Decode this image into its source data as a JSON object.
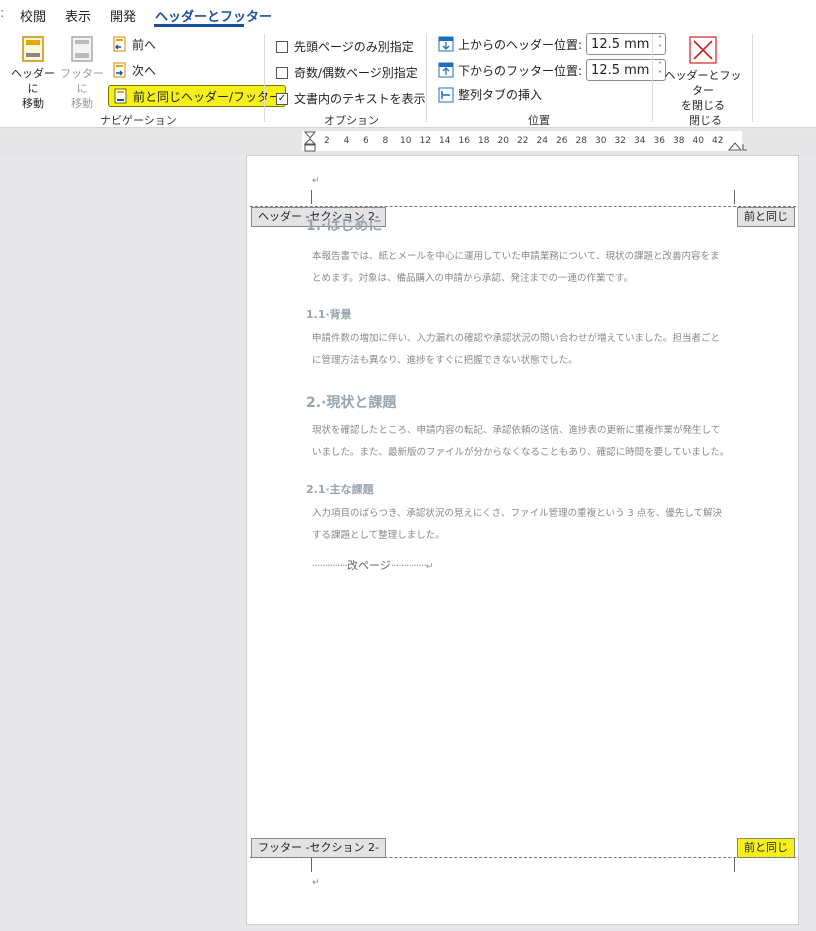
{
  "tabs": [
    {
      "label": "校閲"
    },
    {
      "label": "表示"
    },
    {
      "label": "開発"
    },
    {
      "label": "ヘッダーとフッター"
    }
  ],
  "navigation": {
    "group_label": "ナビゲーション",
    "goto_header_line1": "ヘッダーに",
    "goto_header_line2": "移動",
    "goto_footer_line1": "フッターに",
    "goto_footer_line2": "移動",
    "prev_label": "前へ",
    "next_label": "次へ",
    "link_prev_label": "前と同じヘッダー/フッター"
  },
  "options": {
    "group_label": "オプション",
    "different_first": {
      "label": "先頭ページのみ別指定",
      "checked": false
    },
    "different_odd_even": {
      "label": "奇数/偶数ページ別指定",
      "checked": false
    },
    "show_doc_text": {
      "label": "文書内のテキストを表示",
      "checked": true
    }
  },
  "position": {
    "group_label": "位置",
    "header_from_top_label": "上からのヘッダー位置:",
    "header_from_top_value": "12.5 mm",
    "footer_from_bottom_label": "下からのフッター位置:",
    "footer_from_bottom_value": "12.5 mm",
    "insert_align_tab_label": "整列タブの挿入"
  },
  "close": {
    "group_label": "閉じる",
    "close_line1": "ヘッダーとフッター",
    "close_line2": "を閉じる"
  },
  "ruler": {
    "ticks": [
      "2",
      "4",
      "6",
      "8",
      "10",
      "12",
      "14",
      "16",
      "18",
      "20",
      "22",
      "24",
      "26",
      "28",
      "30",
      "32",
      "34",
      "36",
      "38",
      "40",
      "42"
    ]
  },
  "page": {
    "header_tag": "ヘッダー -セクション 2-",
    "header_same_as_prev": "前と同じ",
    "footer_tag": "フッター -セクション 2-",
    "footer_same_as_prev": "前と同じ",
    "heading1": "1.·はじめに",
    "intro_p1": "本報告書では、紙とメールを中心に運用していた申請業務について、現状の課題と改善内容をま",
    "intro_p2": "とめます。対象は、備品購入の申請から承認、発注までの一連の作業です。",
    "h1_1": "1.1·背景",
    "bg_p1": "申請件数の増加に伴い、入力漏れの確認や承認状況の問い合わせが増えていました。担当者ごと",
    "bg_p2": "に管理方法も異なり、進捗をすぐに把握できない状態でした。",
    "heading2": "2.·現状と課題",
    "st_p1": "現状を確認したところ、申請内容の転記、承認依頼の送信、進捗表の更新に重複作業が発生して",
    "st_p2": "いました。また、最新版のファイルが分からなくなることもあり、確認に時間を要していました。",
    "h2_1": "2.1·主な課題",
    "iss_p1": "入力項目のばらつき、承認状況の見えにくさ、ファイル管理の重複という 3 点を、優先して解決",
    "iss_p2": "する課題として整理しました。",
    "page_break": "改ページ",
    "para_mark": "↵"
  }
}
